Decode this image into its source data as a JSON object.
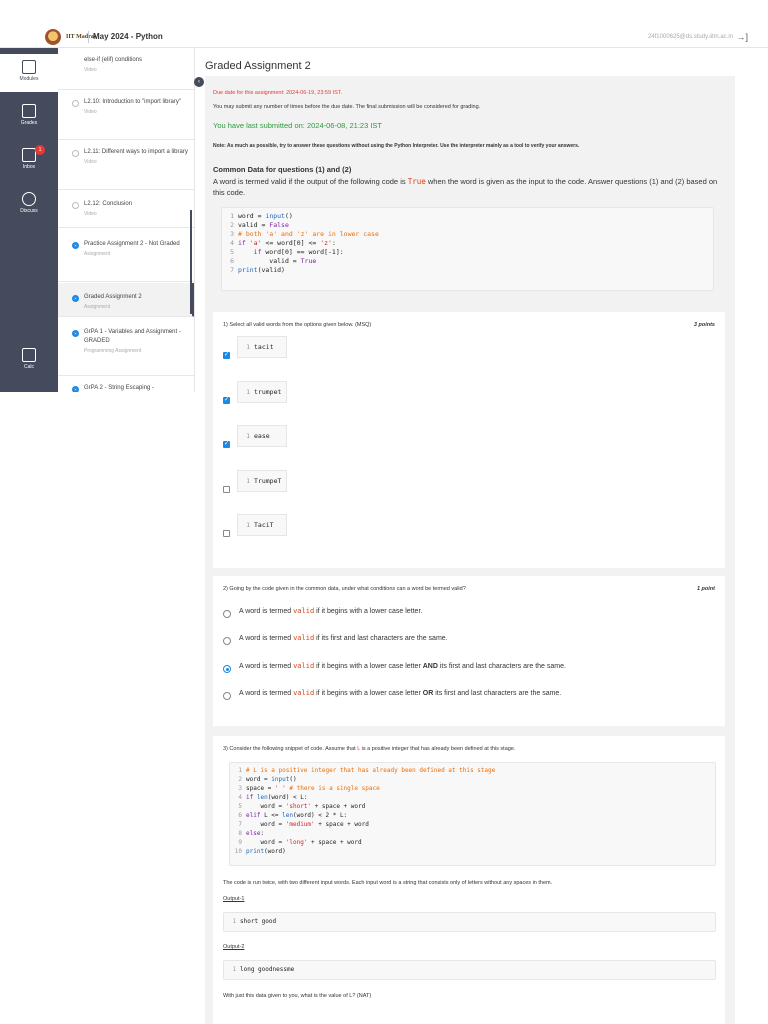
{
  "topbar": {
    "brand": "IIT Madras",
    "course_title": "May 2024 - Python",
    "user_email": "24f1000625@ds.study.iitm.ac.in",
    "logout_icon": "logout-icon"
  },
  "rail": {
    "modules": "Modules",
    "grades": "Grades",
    "inbox": "Inbox",
    "inbox_badge": "1",
    "discuss": "Discuss",
    "calc": "Calc"
  },
  "sidebar": {
    "items": [
      {
        "title": "else-if (elif) conditions",
        "sub": "Video"
      },
      {
        "title": "L2.10: Introduction to \"import library\"",
        "sub": "Video"
      },
      {
        "title": "L2.11: Different ways to import a library",
        "sub": "Video"
      },
      {
        "title": "L2.12: Conclusion",
        "sub": "Video"
      },
      {
        "title": "Practice Assignment 2 - Not Graded",
        "sub": "Assignment"
      },
      {
        "title": "Graded Assignment 2",
        "sub": "Assignment"
      },
      {
        "title": "GrPA 1 - Variables and Assignment - GRADED",
        "sub": "Programming Assignment"
      },
      {
        "title": "GrPA 2 - String Escaping -",
        "sub": ""
      }
    ]
  },
  "main": {
    "title": "Graded Assignment 2",
    "due": "Due date for this assignment: 2024-06-19, 23:59 IST.",
    "submit_info": "You may submit any number of times before the due date. The final submission will be considered for grading.",
    "last_submitted": "You have last submitted on: 2024-06-08, 21:23 IST",
    "note": "Note: As much as possible, try to answer these questions without using the Python Interpreter. Use the interpreter mainly as a tool to verify your answers.",
    "common_heading": "Common Data for questions (1) and (2)",
    "common_desc_a": "A word is termed valid if the output of the following code is",
    "common_desc_true": "True",
    "common_desc_b": "when the word is given as the input to the code. Answer questions (1) and (2) based on this code.",
    "common_code": [
      "word = input()",
      "valid = False",
      "# both 'a' and 'z' are in lower case",
      "if 'a' <= word[0] <= 'z':",
      "    if word[0] == word[-1]:",
      "        valid = True",
      "print(valid)"
    ]
  },
  "q1": {
    "text": "1) Select all valid words from the options given below. (MSQ)",
    "points": "3 points",
    "options": [
      {
        "word": "tacit",
        "checked": true
      },
      {
        "word": "trumpet",
        "checked": true
      },
      {
        "word": "ease",
        "checked": true
      },
      {
        "word": "TrumpeT",
        "checked": false
      },
      {
        "word": "TaciT",
        "checked": false
      }
    ]
  },
  "q2": {
    "text": "2) Going by the code given in the common data, under what conditions can a word be termed valid?",
    "points": "1 point",
    "prefix": "A word is termed",
    "valid_word": "valid",
    "options": [
      {
        "rest": "if it begins with a lower case letter.",
        "selected": false
      },
      {
        "rest": "if its first and last characters are the same.",
        "selected": false
      },
      {
        "rest_a": "if it begins with a lower case letter",
        "join": "AND",
        "rest_b": "its first and last characters are the same.",
        "selected": true
      },
      {
        "rest_a": "if it begins with a lower case letter",
        "join": "OR",
        "rest_b": "its first and last characters are the same.",
        "selected": false
      }
    ]
  },
  "q3": {
    "text_a": "3) Consider the following snippet of code. Assume that",
    "var": "L",
    "text_b": "is a positive integer that has already been defined at this stage.",
    "code": [
      "# L is a positive integer that has already been defined at this stage",
      "word = input()",
      "space = ' ' # there is a single space",
      "if len(word) < L:",
      "    word = 'short' + space + word",
      "elif L <= len(word) < 2 * L:",
      "    word = 'medium' + space + word",
      "else:",
      "    word = 'long' + space + word",
      "print(word)"
    ],
    "run_text": "The code is run twice, with two different input words. Each input word is a string that consists only of letters without any spaces in them.",
    "output1_label": "Output-1",
    "output1": "short good",
    "output2_label": "Output-2",
    "output2": "long goodnessme",
    "final_text": "With just this data given to you, what is the value of L? (NAT)"
  }
}
